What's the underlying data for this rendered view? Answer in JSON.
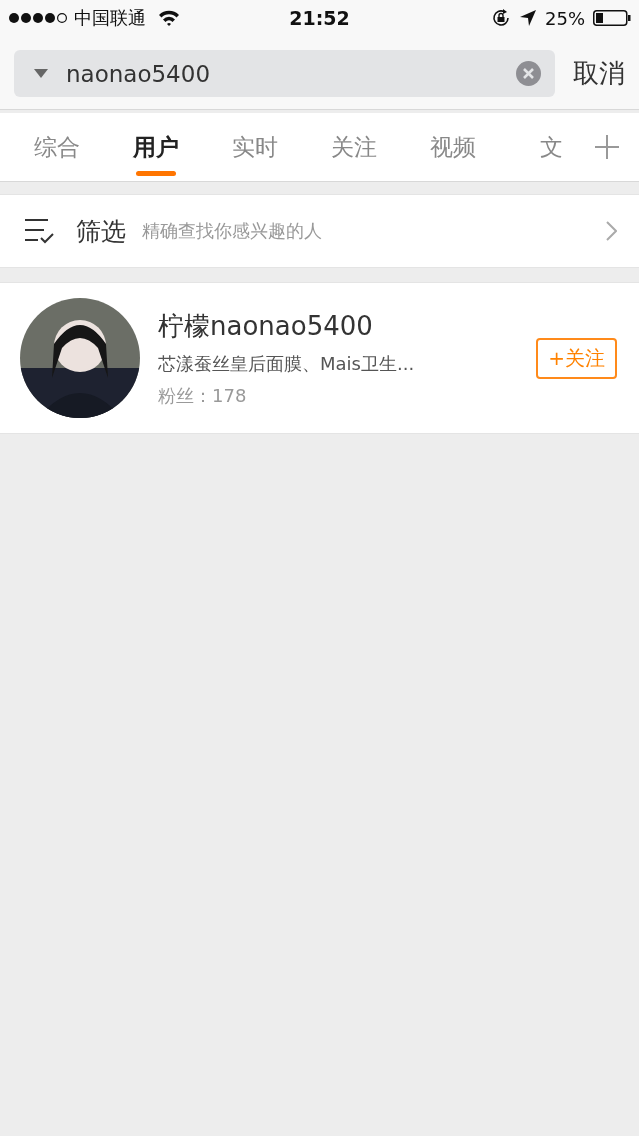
{
  "status_bar": {
    "carrier": "中国联通",
    "time": "21:52",
    "battery": "25%"
  },
  "search": {
    "value": "naonao5400",
    "cancel": "取消"
  },
  "tabs": [
    {
      "label": "综合",
      "selected": false
    },
    {
      "label": "用户",
      "selected": true
    },
    {
      "label": "实时",
      "selected": false
    },
    {
      "label": "关注",
      "selected": false
    },
    {
      "label": "视频",
      "selected": false
    },
    {
      "label": "文",
      "selected": false
    }
  ],
  "filter": {
    "title": "筛选",
    "hint": "精确查找你感兴趣的人"
  },
  "users": [
    {
      "name": "柠檬naonao5400",
      "description": "芯漾蚕丝皇后面膜、Mais卫生...",
      "fans": "粉丝：178",
      "follow": "+关注"
    }
  ]
}
